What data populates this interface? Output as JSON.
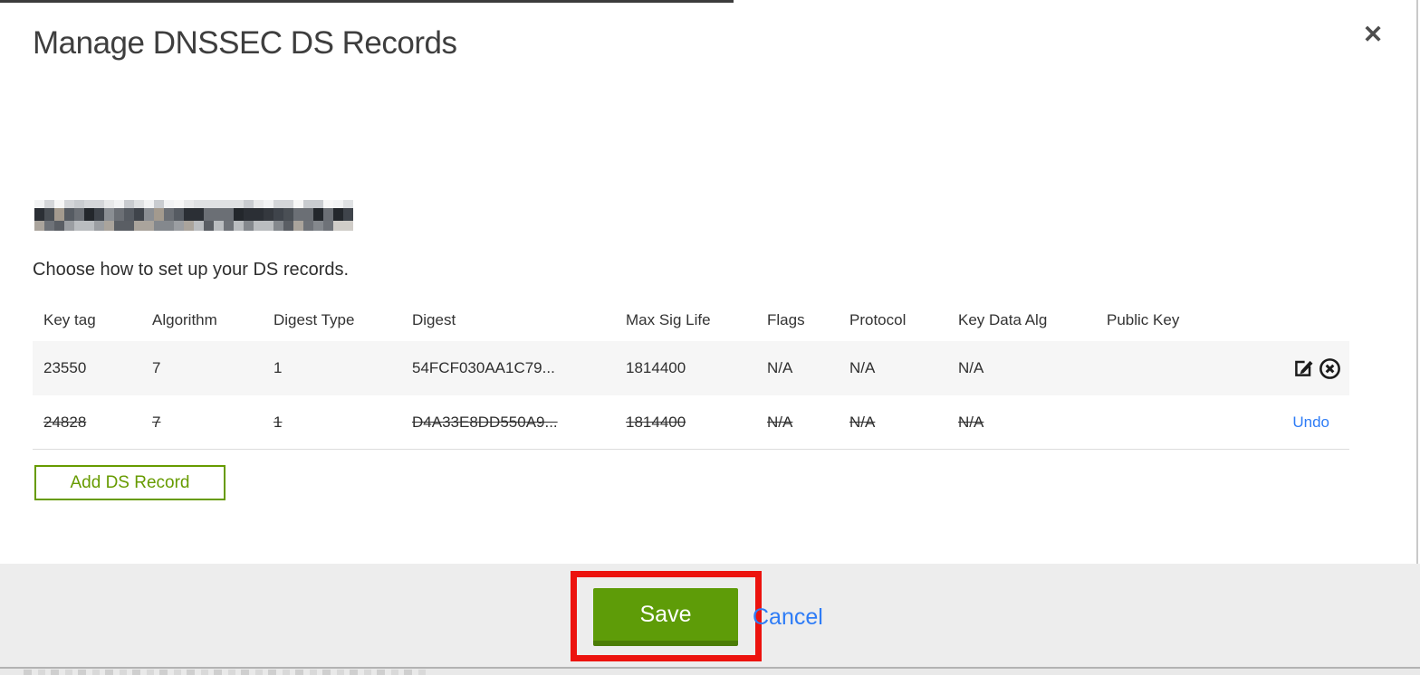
{
  "dialog": {
    "title": "Manage DNSSEC DS Records",
    "close_glyph": "✕"
  },
  "intro_text": "Choose how to set up your DS records.",
  "redaction": {
    "note": "pixelated-domain-name",
    "palette_top": [
      "#f2f3f4",
      "#dfe1e3",
      "#c9ccd0",
      "#e8e9ea",
      "#d4d6d9",
      "#f7f7f7"
    ],
    "palette_mid": [
      "#34383e",
      "#23272c",
      "#565b62",
      "#6b6f75",
      "#3f444b",
      "#8a8e93",
      "#a39a8e",
      "#2b2f35",
      "#75797f",
      "#4a4f55"
    ],
    "palette_bot": [
      "#9b9ea2",
      "#babdc0",
      "#6e7278",
      "#84888d",
      "#d0cdc8",
      "#5a5e64",
      "#aaa49c"
    ]
  },
  "table": {
    "columns": [
      "Key tag",
      "Algorithm",
      "Digest Type",
      "Digest",
      "Max Sig Life",
      "Flags",
      "Protocol",
      "Key Data Alg",
      "Public Key"
    ],
    "rows": [
      {
        "cells": [
          "23550",
          "7",
          "1",
          "54FCF030AA1C79...",
          "1814400",
          "N/A",
          "N/A",
          "N/A",
          ""
        ],
        "state": "active",
        "actions": [
          "edit",
          "delete"
        ]
      },
      {
        "cells": [
          "24828",
          "7",
          "1",
          "D4A33E8DD550A9...",
          "1814400",
          "N/A",
          "N/A",
          "N/A",
          ""
        ],
        "state": "deleted",
        "undo_label": "Undo"
      }
    ]
  },
  "add_button_label": "Add DS Record",
  "footer": {
    "save_label": "Save",
    "cancel_label": "Cancel"
  },
  "colors": {
    "accent_green": "#5e9c08",
    "accent_green_dark": "#4a7c05",
    "outline_green": "#679b00",
    "link_blue": "#2e7cf6",
    "annotation_red": "#ec130e",
    "footer_gray": "#ededed",
    "row_stripe_gray": "#f6f6f6"
  }
}
